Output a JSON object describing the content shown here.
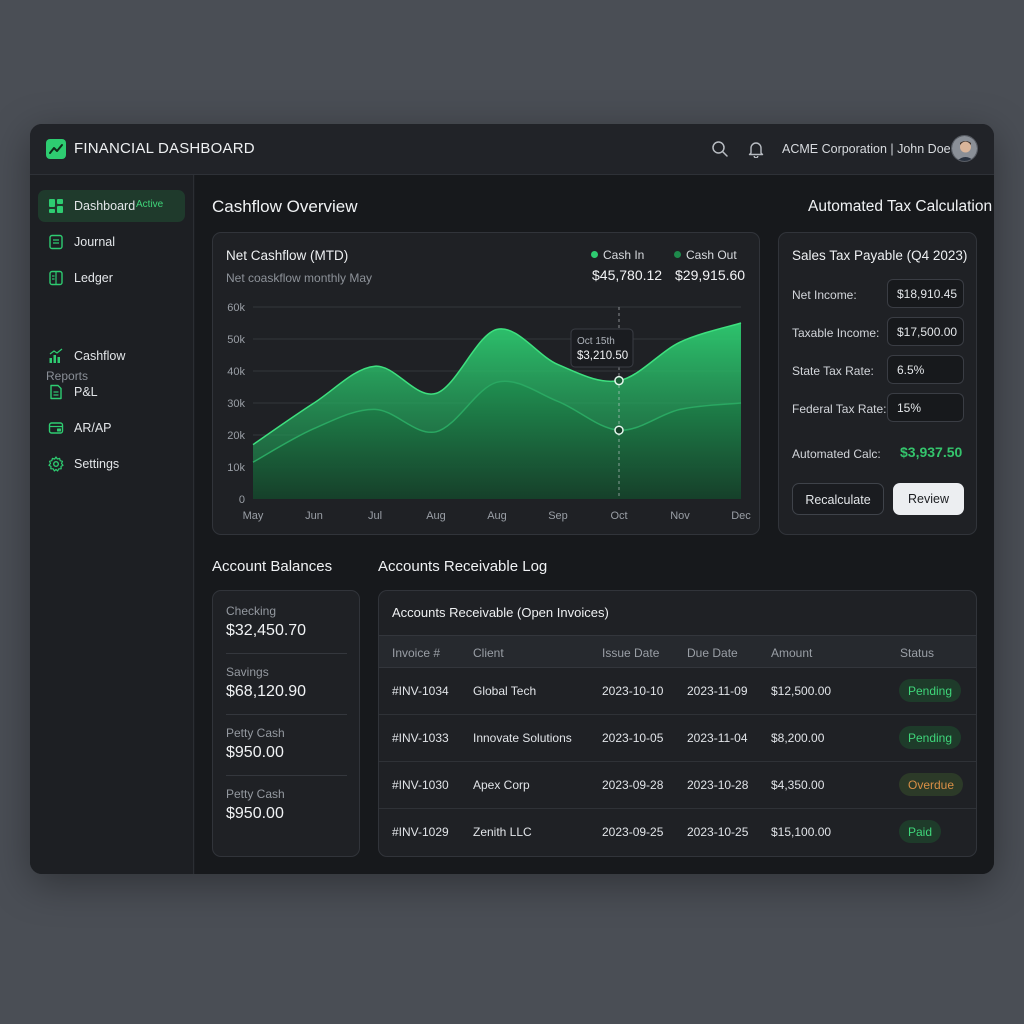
{
  "app": {
    "title": "FINANCIAL DASHBOARD",
    "company_user": "ACME Corporation | John Doe"
  },
  "sidebar": {
    "items": [
      {
        "label": "Dashboard",
        "badge": "Active",
        "icon": "dashboard-icon"
      },
      {
        "label": "Journal",
        "icon": "journal-icon"
      },
      {
        "label": "Ledger",
        "icon": "ledger-icon"
      }
    ],
    "section": "Reports",
    "report_items": [
      {
        "label": "Cashflow",
        "icon": "chart-icon"
      },
      {
        "label": "P&L",
        "icon": "document-icon"
      },
      {
        "label": "AR/AP",
        "icon": "folder-icon"
      },
      {
        "label": "Settings",
        "icon": "gear-icon"
      }
    ]
  },
  "cashflow": {
    "heading": "Cashflow Overview",
    "card_title": "Net Cashflow (MTD)",
    "subtitle": "Net coaskflow monthly May",
    "legend": [
      {
        "name": "Cash In",
        "value": "$45,780.12",
        "color": "#2ecc71"
      },
      {
        "name": "Cash Out",
        "value": "$29,915.60",
        "color": "#1e8a4c"
      }
    ],
    "tooltip": {
      "date": "Oct 15th",
      "value": "$3,210.50"
    }
  },
  "chart_data": {
    "type": "area",
    "categories": [
      "May",
      "Jun",
      "Jul",
      "Aug",
      "Aug",
      "Sep",
      "Oct",
      "Nov",
      "Dec"
    ],
    "y_ticks": [
      "0",
      "10k",
      "20k",
      "30k",
      "40k",
      "50k",
      "60k"
    ],
    "ylim": [
      0,
      60000
    ],
    "grid": true,
    "series": [
      {
        "name": "Cash In",
        "values": [
          17000,
          30000,
          41500,
          33000,
          53000,
          42000,
          37000,
          49000,
          55000
        ]
      },
      {
        "name": "Cash Out",
        "values": [
          11500,
          22000,
          28000,
          21000,
          36500,
          30500,
          21500,
          28000,
          30000
        ]
      }
    ]
  },
  "tax": {
    "heading": "Automated Tax Calculation",
    "card_title": "Sales Tax Payable (Q4 2023)",
    "rows": [
      {
        "label": "Net Income:",
        "value": "$18,910.45"
      },
      {
        "label": "Taxable Income:",
        "value": "$17,500.00"
      },
      {
        "label": "State Tax Rate:",
        "value": "6.5%"
      },
      {
        "label": "Federal Tax Rate:",
        "value": "15%"
      }
    ],
    "calc_label": "Automated Calc:",
    "calc_value": "$3,937.50",
    "recalc_label": "Recalculate",
    "review_label": "Review"
  },
  "balances": {
    "heading": "Account Balances",
    "items": [
      {
        "label": "Checking",
        "value": "$32,450.70"
      },
      {
        "label": "Savings",
        "value": "$68,120.90"
      },
      {
        "label": "Petty Cash",
        "value": "$950.00"
      },
      {
        "label": "Petty Cash",
        "value": "$950.00"
      }
    ]
  },
  "receivables": {
    "heading": "Accounts Receivable Log",
    "card_title": "Accounts Receivable (Open Invoices)",
    "columns": [
      "Invoice #",
      "Client",
      "Issue Date",
      "Due Date",
      "Amount",
      "Status"
    ],
    "rows": [
      {
        "invoice": "#INV-1034",
        "client": "Global Tech",
        "issue": "2023-10-10",
        "due": "2023-11-09",
        "amount": "$12,500.00",
        "status": "Pending"
      },
      {
        "invoice": "#INV-1033",
        "client": "Innovate Solutions",
        "issue": "2023-10-05",
        "due": "2023-11-04",
        "amount": "$8,200.00",
        "status": "Pending"
      },
      {
        "invoice": "#INV-1030",
        "client": "Apex Corp",
        "issue": "2023-09-28",
        "due": "2023-10-28",
        "amount": "$4,350.00",
        "status": "Overdue"
      },
      {
        "invoice": "#INV-1029",
        "client": "Zenith LLC",
        "issue": "2023-09-25",
        "due": "2023-10-25",
        "amount": "$15,100.00",
        "status": "Paid"
      }
    ]
  }
}
